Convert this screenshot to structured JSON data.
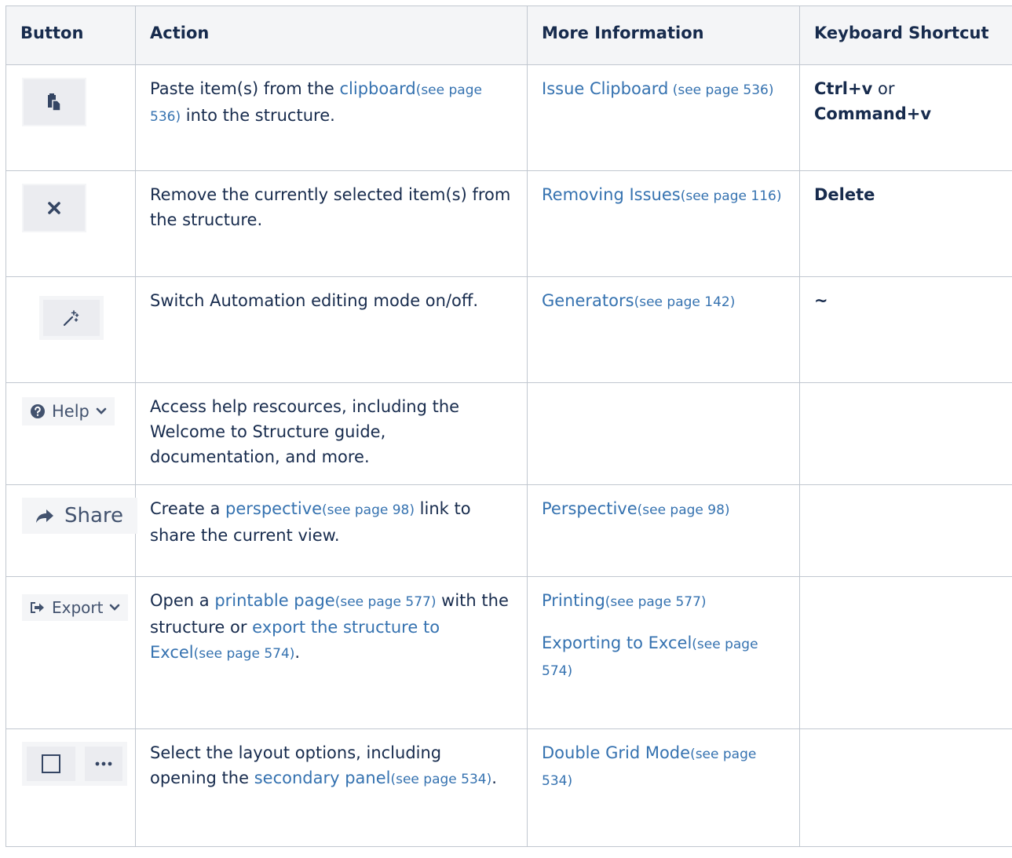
{
  "headers": [
    "Button",
    "Action",
    "More Information",
    "Keyboard Shortcut"
  ],
  "rows": [
    {
      "button": {
        "icon": "paste-icon"
      },
      "action": {
        "pre": "Paste item(s) from the ",
        "link": "clipboard",
        "ref": "(see page 536)",
        "post": " into the structure."
      },
      "more": [
        {
          "link": "Issue Clipboard",
          "ref": " (see page 536)"
        }
      ],
      "shortcut": {
        "k1": "Ctrl+v",
        "mid": " or ",
        "k2": "Command+v"
      }
    },
    {
      "button": {
        "icon": "remove-icon"
      },
      "action": {
        "text": "Remove the currently selected item(s) from the structure."
      },
      "more": [
        {
          "link": "Removing Issues",
          "ref": "(see page 116)"
        }
      ],
      "shortcut": {
        "k1": "Delete"
      }
    },
    {
      "button": {
        "icon": "magic-wand-icon"
      },
      "action": {
        "text": "Switch Automation editing mode on/off."
      },
      "more": [
        {
          "link": "Generators",
          "ref": "(see page 142)"
        }
      ],
      "shortcut": {
        "k1": "~"
      }
    },
    {
      "button": {
        "label": "Help",
        "icon": "question-circle-icon",
        "caret": "chevron-down-icon"
      },
      "action": {
        "text": "Access help rescources, including the Welcome to Structure guide, documentation, and more."
      },
      "more": [],
      "shortcut": {}
    },
    {
      "button": {
        "label": "Share",
        "icon": "share-arrow-icon"
      },
      "action": {
        "pre": "Create a ",
        "link": "perspective",
        "ref": "(see page 98)",
        "post": " link to share the current view."
      },
      "more": [
        {
          "link": "Perspective",
          "ref": "(see page 98)"
        }
      ],
      "shortcut": {}
    },
    {
      "button": {
        "label": "Export",
        "icon": "export-icon",
        "caret": "chevron-down-icon"
      },
      "action": {
        "pre": "Open a ",
        "link": "printable page",
        "ref": "(see page 577)",
        "mid": " with the structure or ",
        "link2": "export the structure to Excel",
        "ref2": "(see page 574)",
        "post": "."
      },
      "more": [
        {
          "link": "Printing",
          "ref": "(see page 577)"
        },
        {
          "link": "Exporting to Excel",
          "ref": "(see page 574)"
        }
      ],
      "shortcut": {}
    },
    {
      "button": {
        "icons": [
          "square-icon",
          "ellipsis-icon"
        ]
      },
      "action": {
        "pre": "Select the layout options, including opening the ",
        "link": "secondary panel",
        "ref": "(see page 534)",
        "post": "."
      },
      "more": [
        {
          "link": "Double Grid Mode",
          "ref": "(see page 534)"
        }
      ],
      "shortcut": {}
    }
  ]
}
